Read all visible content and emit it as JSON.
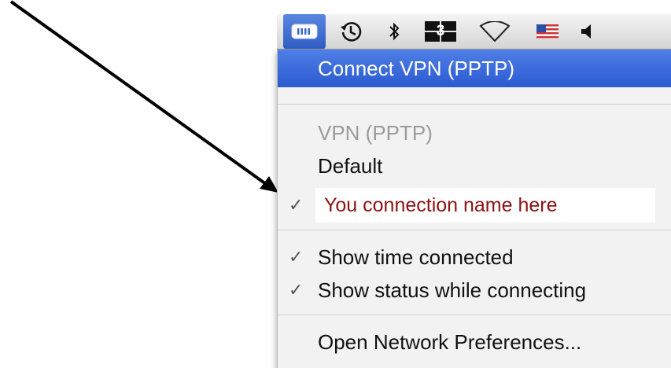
{
  "menubar": {
    "icons": [
      "vpn-status-icon",
      "time-machine-icon",
      "bluetooth-icon",
      "spaces-icon",
      "wifi-icon",
      "flag-icon",
      "volume-icon"
    ],
    "spaces_number": "3",
    "colors": {
      "highlight": "#2f5dc4",
      "connection_text": "#8b1212"
    }
  },
  "menu": {
    "connect": "Connect VPN (PPTP)",
    "vpn_header": "VPN (PPTP)",
    "default": "Default",
    "connection_name": "You connection name here",
    "show_time": "Show time connected",
    "show_status": "Show status while connecting",
    "open_prefs": "Open Network Preferences...",
    "checkmark": "✓"
  }
}
